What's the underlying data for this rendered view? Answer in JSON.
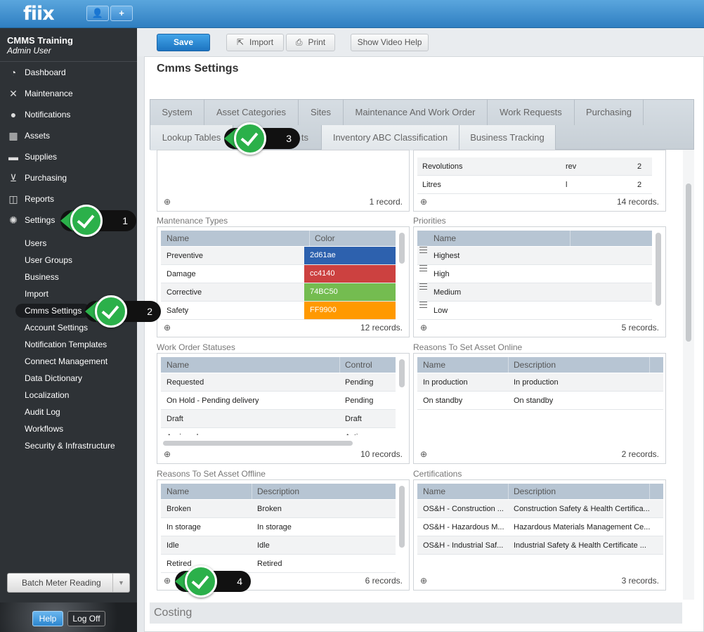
{
  "brand": {
    "logo": "fiix",
    "user_btn": "👤",
    "add_btn": "+"
  },
  "org": {
    "name": "CMMS Training",
    "user": "Admin User"
  },
  "nav": [
    {
      "label": "Dashboard",
      "icon": "dashboard-icon"
    },
    {
      "label": "Maintenance",
      "icon": "wrench-icon"
    },
    {
      "label": "Notifications",
      "icon": "speech-bubble-icon"
    },
    {
      "label": "Assets",
      "icon": "boxes-icon"
    },
    {
      "label": "Supplies",
      "icon": "truck-icon"
    },
    {
      "label": "Purchasing",
      "icon": "cart-icon"
    },
    {
      "label": "Reports",
      "icon": "chart-icon"
    },
    {
      "label": "Settings",
      "icon": "gear-icon"
    }
  ],
  "settings_sub": [
    "Users",
    "User Groups",
    "Business",
    "Import",
    "Cmms Settings",
    "Account Settings",
    "Notification Templates",
    "Connect Management",
    "Data Dictionary",
    "Localization",
    "Audit Log",
    "Workflows",
    "Security & Infrastructure"
  ],
  "sidebar_footer": {
    "batch": "Batch Meter Reading",
    "help": "Help",
    "logoff": "Log Off"
  },
  "toolbar": {
    "save": "Save",
    "import": "Import",
    "print": "Print",
    "video": "Show Video Help"
  },
  "page_title": "Cmms Settings",
  "tabs_row1": [
    "System",
    "Asset Categories",
    "Sites",
    "Maintenance And Work Order",
    "Work Requests",
    "Purchasing"
  ],
  "tabs_row2": [
    "Lookup Tables",
    "ts",
    "Inventory ABC Classification",
    "Business Tracking"
  ],
  "top_left_box": {
    "records": "1 record."
  },
  "top_right_box": {
    "rows": [
      [
        "Revolutions",
        "rev",
        "2"
      ],
      [
        "Litres",
        "l",
        "2"
      ]
    ],
    "records": "14 records."
  },
  "maint_types": {
    "title": "Mantenance Types",
    "cols": [
      "Name",
      "Color"
    ],
    "rows": [
      {
        "name": "Preventive",
        "color": "2d61ae",
        "hex": "#2d61ae"
      },
      {
        "name": "Damage",
        "color": "cc4140",
        "hex": "#cc4140"
      },
      {
        "name": "Corrective",
        "color": "74BC50",
        "hex": "#74BC50"
      },
      {
        "name": "Safety",
        "color": "FF9900",
        "hex": "#FF9900"
      }
    ],
    "records": "12 records."
  },
  "priorities": {
    "title": "Priorities",
    "cols": [
      "Name"
    ],
    "rows": [
      "Highest",
      "High",
      "Medium",
      "Low"
    ],
    "records": "5 records."
  },
  "wo_statuses": {
    "title": "Work Order Statuses",
    "cols": [
      "Name",
      "Control"
    ],
    "rows": [
      [
        "Requested",
        "Pending"
      ],
      [
        "On Hold - Pending delivery",
        "Pending"
      ],
      [
        "Draft",
        "Draft"
      ],
      [
        "Assigned",
        "Active"
      ]
    ],
    "records": "10 records."
  },
  "online": {
    "title": "Reasons To Set Asset Online",
    "cols": [
      "Name",
      "Description"
    ],
    "rows": [
      [
        "In production",
        "In production"
      ],
      [
        "On standby",
        "On standby"
      ]
    ],
    "records": "2 records."
  },
  "offline": {
    "title": "Reasons To Set Asset Offline",
    "cols": [
      "Name",
      "Description"
    ],
    "rows": [
      [
        "Broken",
        "Broken"
      ],
      [
        "In storage",
        "In storage"
      ],
      [
        "Idle",
        "Idle"
      ],
      [
        "Retired",
        "Retired"
      ]
    ],
    "records": "6 records."
  },
  "certs": {
    "title": "Certifications",
    "cols": [
      "Name",
      "Description"
    ],
    "rows": [
      [
        "OS&H - Construction ...",
        "Construction Safety & Health Certifica..."
      ],
      [
        "OS&H - Hazardous M...",
        "Hazardous Materials Management Ce..."
      ],
      [
        "OS&H - Industrial Saf...",
        "Industrial Safety & Health Certificate ..."
      ]
    ],
    "records": "3 records."
  },
  "costing": "Costing",
  "callouts": [
    "1",
    "2",
    "3",
    "4"
  ]
}
